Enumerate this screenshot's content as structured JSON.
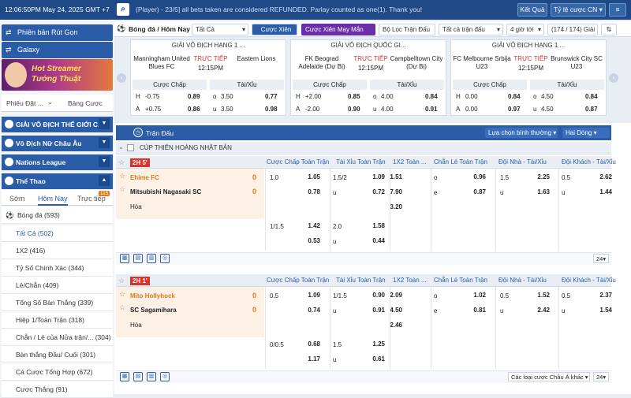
{
  "topbar": {
    "clock": "12:06:50PM May 24, 2025 GMT +7",
    "ticker": "(Player) - 23/5] all bets taken are considered REFUNDED. Parlay counted as one(1). Thank you!",
    "result_btn": "Kết Quả",
    "odds_btn": "Tỷ lệ cược CN"
  },
  "sidebar": {
    "promo1": "Phiên bản Rút Gọn",
    "promo2": "Galaxy",
    "banner_l1": "Hot Streamer",
    "banner_l2": "Tướng Thuật",
    "tab_left": "Phiếu Đặt ...",
    "tab_right": "Bảng Cược",
    "leagues": [
      "GIẢI VÔ ĐỊCH THẾ GIỚI C...",
      "Vô Địch Nữ Châu Âu",
      "Nations League",
      "Thể Thao"
    ],
    "time_tabs": {
      "early": "Sớm",
      "today": "Hôm Nay",
      "live": "Trực tiếp",
      "live_badge": "115"
    },
    "sport": "Bóng đá",
    "sport_count": "(593)",
    "items": [
      {
        "l": "Tất Cả",
        "c": "(502)"
      },
      {
        "l": "1X2",
        "c": "(416)"
      },
      {
        "l": "Tỷ Số Chính Xác",
        "c": "(344)"
      },
      {
        "l": "Lẻ/Chẵn",
        "c": "(409)"
      },
      {
        "l": "Tổng Số Bàn Thắng",
        "c": "(339)"
      },
      {
        "l": "Hiệp 1/Toàn Trận",
        "c": "(318)"
      },
      {
        "l": "Chẵn / Lẻ của Nửa trận/...",
        "c": "(304)"
      },
      {
        "l": "Bàn thắng Đầu/ Cuối",
        "c": "(301)"
      },
      {
        "l": "Cá Cược Tổng Hợp",
        "c": "(672)"
      },
      {
        "l": "Cược Thắng",
        "c": "(91)"
      }
    ]
  },
  "filters": {
    "sport": "Bóng đá / Hôm Nay",
    "all": "Tất Cả",
    "parlay": "Cược Xiên",
    "parlay_luck": "Cược Xiên May Mắn",
    "league_filter": "Bộ Lọc Trận Đấu",
    "all_matches": "Tất cả trận đấu",
    "hours": "4 giờ tới",
    "count": "(174 / 174) Giải"
  },
  "cards": [
    {
      "league": "GIẢI VÔ ĐỊCH HẠNG 1 ...",
      "home": "Manningham United Blues FC",
      "away": "Eastern Lions",
      "live": "TRỰC TIẾP",
      "time": "12:15PM",
      "hh": "Cược Chấp",
      "ha": "Tài/Xỉu",
      "r1": [
        "H",
        "-0.75",
        "0.89",
        "o",
        "3.50",
        "0.77"
      ],
      "r2": [
        "A",
        "+0.75",
        "0.86",
        "u",
        "3.50",
        "0.98"
      ]
    },
    {
      "league": "GIẢI VÔ ĐỊCH QUỐC GI...",
      "home": "FK Beograd Adelaide (Dự Bị)",
      "away": "Campbelltown City (Dự Bị)",
      "live": "TRỰC TIẾP",
      "time": "12:15PM",
      "hh": "Cược Chấp",
      "ha": "Tài/Xỉu",
      "r1": [
        "H",
        "+2.00",
        "0.85",
        "o",
        "4.00",
        "0.84"
      ],
      "r2": [
        "A",
        "-2.00",
        "0.90",
        "u",
        "4.00",
        "0.91"
      ]
    },
    {
      "league": "GIẢI VÔ ĐỊCH HẠNG 1 ...",
      "home": "FC Melbourne Srbija U23",
      "away": "Brunswick City SC U23",
      "live": "TRỰC TIẾP",
      "time": "12:15PM",
      "hh": "Cược Chấp",
      "ha": "Tài/Xỉu",
      "r1": [
        "H",
        "0.00",
        "0.84",
        "o",
        "4.50",
        "0.84"
      ],
      "r2": [
        "A",
        "0.00",
        "0.97",
        "u",
        "4.50",
        "0.87"
      ]
    }
  ],
  "main": {
    "strip_title": "Trận Đấu",
    "strip_sort": "Lựa chọn bình thường",
    "strip_view": "Hai Dòng",
    "league_name": "CÚP THIÊN HOÀNG NHẬT BẢN",
    "cols": [
      "Cược Chấp Toàn Trận",
      "Tài Xỉu Toàn Trận",
      "1X2 Toàn ...",
      "Chẵn Lẻ Toàn Trận",
      "Đội Nhà - Tài/Xỉu",
      "Đội Khách - Tài/Xỉu"
    ],
    "m1": {
      "tag": "2H 5'",
      "home": "Ehime FC",
      "away": "Mitsubishi Nagasaki SC",
      "draw": "Hòa",
      "hs": "0",
      "as": "0",
      "r1": [
        "1.0",
        "1.05",
        "1.5/2",
        "1.09",
        "1.51",
        "o",
        "0.96",
        "1.5",
        "2.25",
        "0.5",
        "2.62"
      ],
      "r2": [
        "",
        "0.78",
        "u",
        "0.72",
        "7.90",
        "e",
        "0.87",
        "u",
        "1.63",
        "u",
        "1.44"
      ],
      "r3": "3.20",
      "s1": [
        "1/1.5",
        "1.42",
        "2.0",
        "1.58"
      ],
      "s2": [
        "",
        "0.53",
        "u",
        "0.44"
      ],
      "per": "24"
    },
    "m2": {
      "tag": "2H 1'",
      "home": "Mito Hollyhock",
      "away": "SC Sagamihara",
      "draw": "Hòa",
      "hs": "0",
      "as": "0",
      "r1": [
        "0.5",
        "1.09",
        "1/1.5",
        "0.90",
        "2.09",
        "o",
        "1.02",
        "0.5",
        "1.52",
        "0.5",
        "2.37"
      ],
      "r2": [
        "",
        "0.74",
        "u",
        "0.91",
        "4.50",
        "e",
        "0.81",
        "u",
        "2.42",
        "u",
        "1.54"
      ],
      "r3": "2.46",
      "s1": [
        "0/0.5",
        "0.68",
        "1.5",
        "1.25"
      ],
      "s2": [
        "",
        "1.17",
        "u",
        "0.61"
      ],
      "footer_sel": "Các loại cược Châu Á khác",
      "per": "24"
    }
  }
}
